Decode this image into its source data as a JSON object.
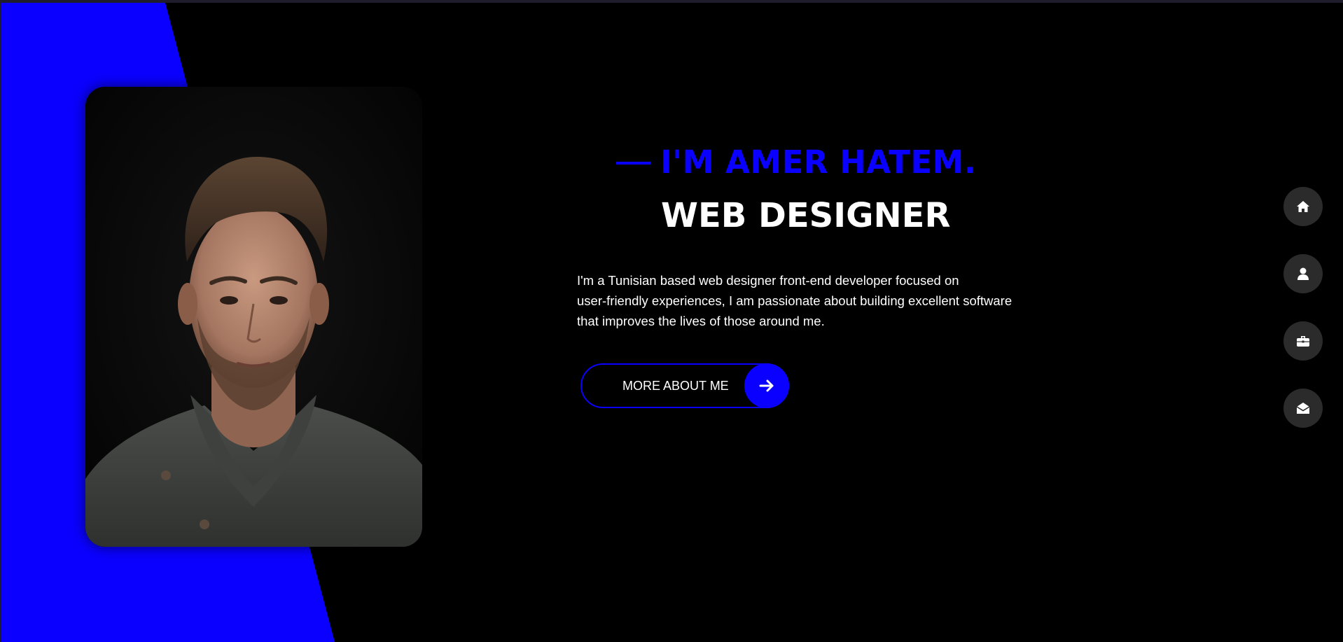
{
  "theme": {
    "accent": "#0a00ff",
    "background": "#000000",
    "nav_button_bg": "#2b2b2b",
    "text": "#ffffff"
  },
  "hero": {
    "intro": "I'M AMER HATEM.",
    "role": "WEB DESIGNER",
    "description_lines": [
      "I'm a Tunisian based web designer front-end developer focused on",
      "user-friendly experiences, I am passionate about building excellent software",
      "that improves the lives of those around me."
    ],
    "cta_label": "MORE ABOUT ME",
    "cta_icon": "arrow-right-icon"
  },
  "nav": {
    "items": [
      {
        "name": "home",
        "icon": "home-icon"
      },
      {
        "name": "about",
        "icon": "user-icon"
      },
      {
        "name": "portfolio",
        "icon": "briefcase-icon"
      },
      {
        "name": "contact",
        "icon": "envelope-open-icon"
      }
    ]
  }
}
